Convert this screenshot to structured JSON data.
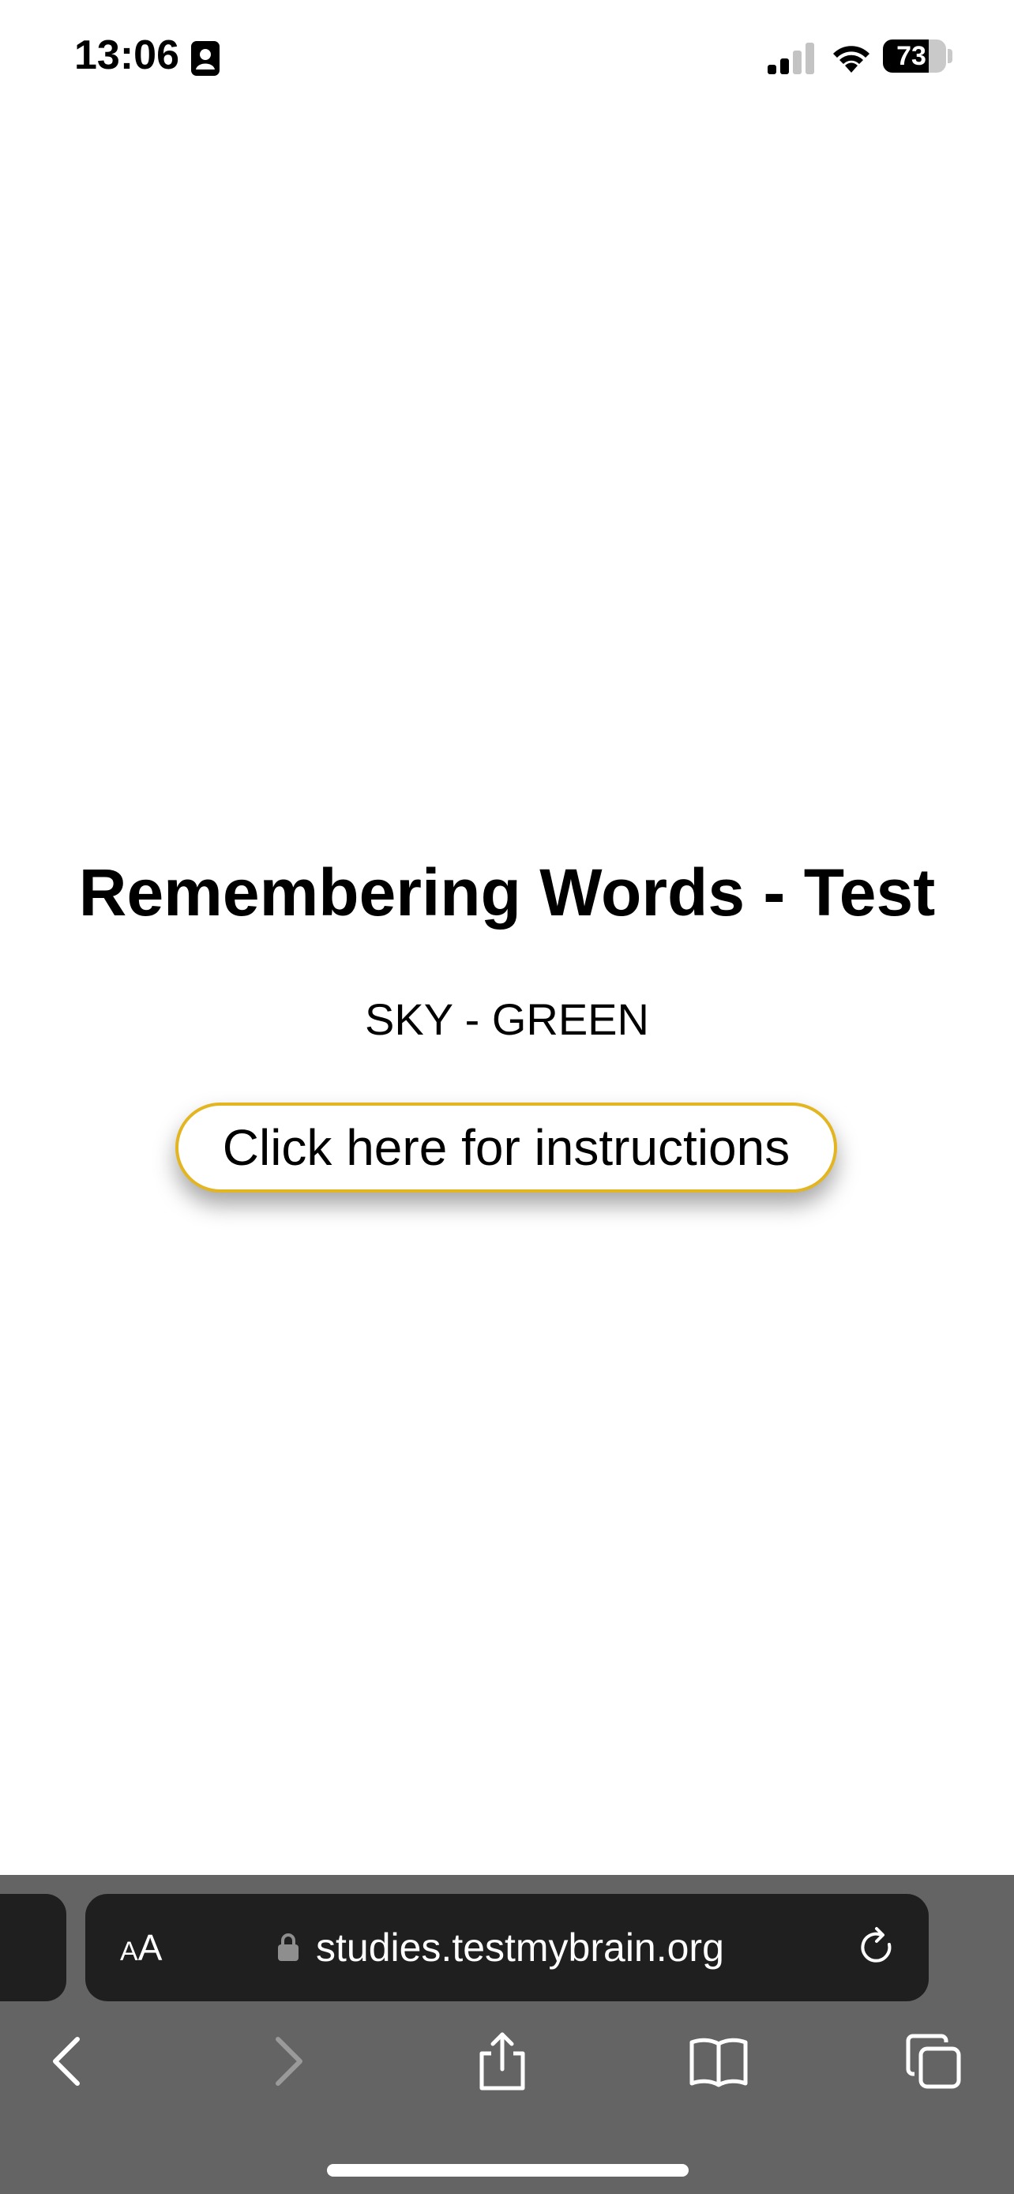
{
  "status_bar": {
    "time": "13:06",
    "battery_level": "73",
    "battery_fraction": 0.73,
    "icons": [
      "id-card-icon",
      "cellular-signal-icon",
      "wifi-icon",
      "battery-icon"
    ]
  },
  "page": {
    "title": "Remembering Words - Test",
    "word_pair": "SKY - GREEN",
    "instructions_button": "Click here for instructions",
    "button_border_color": "#e2b521"
  },
  "browser": {
    "text_size_label_small": "A",
    "text_size_label_big": "A",
    "url": "studies.testmybrain.org",
    "toolbar_color": "#646464",
    "icons": [
      "lock-icon",
      "reload-icon",
      "back-icon",
      "forward-icon",
      "share-icon",
      "bookmarks-icon",
      "tabs-icon"
    ]
  }
}
